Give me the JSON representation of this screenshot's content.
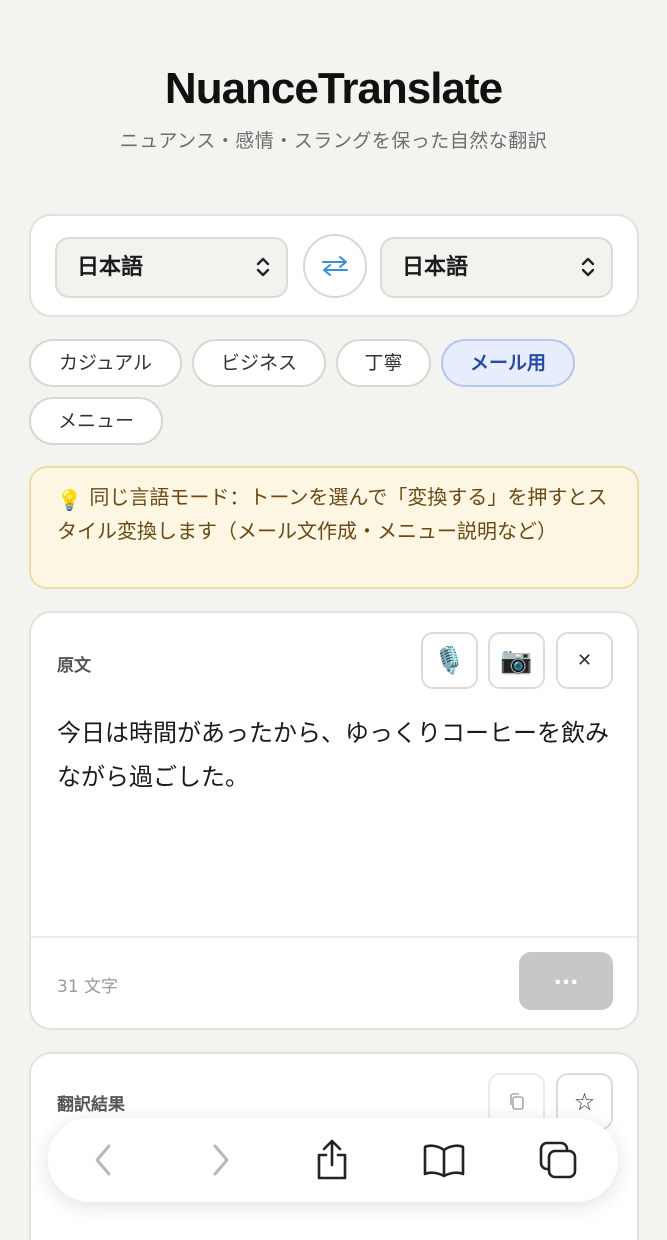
{
  "app": {
    "title": "NuanceTranslate",
    "subtitle": "ニュアンス・感情・スラングを保った自然な翻訳"
  },
  "languages": {
    "source": "日本語",
    "target": "日本語"
  },
  "tones": [
    {
      "label": "カジュアル",
      "active": false
    },
    {
      "label": "ビジネス",
      "active": false
    },
    {
      "label": "丁寧",
      "active": false
    },
    {
      "label": "メール用",
      "active": true
    },
    {
      "label": "メニュー",
      "active": false
    }
  ],
  "tip": {
    "icon": "💡",
    "text": "同じ言語モード：トーンを選んで「変換する」を押すとスタイル変換します（メール文作成・メニュー説明など）"
  },
  "source_card": {
    "label": "原文",
    "icons": [
      "microphone-icon",
      "camera-icon",
      "close-icon"
    ],
    "mic_glyph": "🎙️",
    "camera_glyph": "📷",
    "close_glyph": "✕",
    "text": "今日は時間があったから、ゆっくりコーヒーを飲みながら過ごした。",
    "char_count": "31 文字",
    "submit_label": "..."
  },
  "result_card": {
    "label": "翻訳結果",
    "icons": [
      "copy-icon",
      "star-icon"
    ],
    "star_glyph": "☆"
  },
  "browser_toolbar": {
    "icons": [
      "back-icon",
      "forward-icon",
      "share-icon",
      "bookmarks-icon",
      "tabs-icon"
    ]
  },
  "colors": {
    "background": "#f3f3ef",
    "accent": "#2a4aa8",
    "active_chip_bg": "#e8edfb",
    "tip_bg": "#fdf6e3",
    "disabled_button": "#c7c7c7"
  }
}
